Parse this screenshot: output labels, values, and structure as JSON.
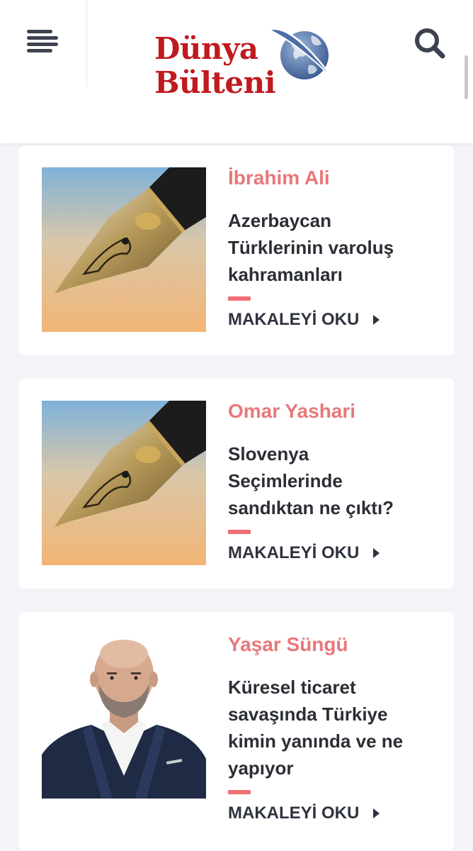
{
  "header": {
    "logo_line1": "Dünya",
    "logo_line2": "Bülteni",
    "menu_icon": "hamburger-menu-icon",
    "search_icon": "search-icon"
  },
  "colors": {
    "brand_red": "#c01a1f",
    "author_pink": "#e8787a",
    "accent": "#ef6f74",
    "text_dark": "#2b2e35",
    "background": "#f3f4f8"
  },
  "articles": [
    {
      "author": "İbrahim Ali",
      "title_lines": [
        "Azerbaycan",
        "Türklerinin varoluş",
        "kahramanları"
      ],
      "read_more": "MAKALEYİ OKU",
      "image": "fountain-pen-nib"
    },
    {
      "author": "Omar Yashari",
      "title_lines": [
        "Slovenya",
        "Seçimlerinde",
        "sandıktan ne çıktı?"
      ],
      "read_more": "MAKALEYİ OKU",
      "image": "fountain-pen-nib"
    },
    {
      "author": "Yaşar Süngü",
      "title_lines": [
        "Küresel ticaret",
        "savaşında Türkiye",
        "kimin yanında ve ne",
        "yapıyor"
      ],
      "read_more": "MAKALEYİ OKU",
      "image": "author-portrait"
    }
  ]
}
